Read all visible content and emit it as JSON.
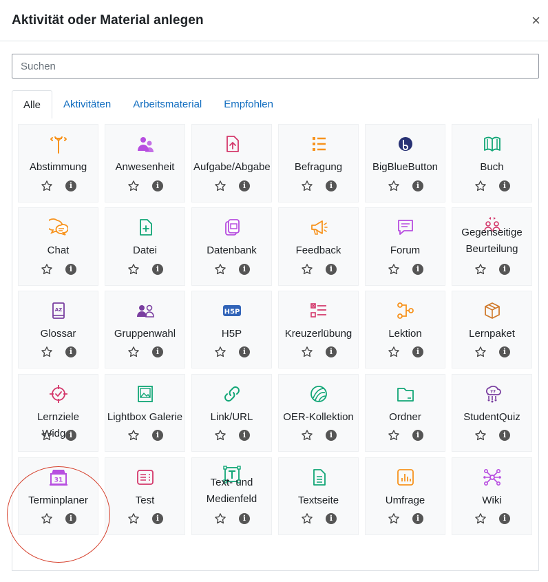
{
  "modal": {
    "title": "Aktivität oder Material anlegen",
    "close_symbol": "×"
  },
  "search": {
    "placeholder": "Suchen",
    "value": ""
  },
  "tabs": [
    {
      "label": "Alle",
      "active": true
    },
    {
      "label": "Aktivitäten",
      "active": false
    },
    {
      "label": "Arbeitsmaterial",
      "active": false
    },
    {
      "label": "Empfohlen",
      "active": false
    }
  ],
  "items": [
    {
      "label": "Abstimmung",
      "icon": "signpost-icon",
      "color": "#f7931e"
    },
    {
      "label": "Anwesenheit",
      "icon": "attendance-icon",
      "color": "#b74ee0"
    },
    {
      "label": "Aufgabe/Abgabe",
      "icon": "file-upload-icon",
      "color": "#d4386b"
    },
    {
      "label": "Befragung",
      "icon": "list-icon",
      "color": "#f7931e"
    },
    {
      "label": "BigBlueButton",
      "icon": "bigbluebutton-icon",
      "color": "#283274"
    },
    {
      "label": "Buch",
      "icon": "book-icon",
      "color": "#11a676"
    },
    {
      "label": "Chat",
      "icon": "chat-icon",
      "color": "#f7931e"
    },
    {
      "label": "Datei",
      "icon": "file-plus-icon",
      "color": "#11a676"
    },
    {
      "label": "Datenbank",
      "icon": "database-icon",
      "color": "#b74ee0"
    },
    {
      "label": "Feedback",
      "icon": "megaphone-icon",
      "color": "#f7931e"
    },
    {
      "label": "Forum",
      "icon": "forum-icon",
      "color": "#b74ee0"
    },
    {
      "label": "Gegenseitige Beurteilung",
      "icon": "peer-review-icon",
      "color": "#d4386b"
    },
    {
      "label": "Glossar",
      "icon": "glossary-icon",
      "color": "#7a3fa0"
    },
    {
      "label": "Gruppenwahl",
      "icon": "group-icon",
      "color": "#7a3fa0"
    },
    {
      "label": "H5P",
      "icon": "h5p-icon",
      "color": "#3264b8"
    },
    {
      "label": "Kreuzerlübung",
      "icon": "checklist-icon",
      "color": "#d4386b"
    },
    {
      "label": "Lektion",
      "icon": "lesson-icon",
      "color": "#f7931e"
    },
    {
      "label": "Lernpaket",
      "icon": "package-icon",
      "color": "#d07a2c"
    },
    {
      "label": "Lernziele Widget",
      "icon": "target-icon",
      "color": "#d4386b"
    },
    {
      "label": "Lightbox Galerie",
      "icon": "gallery-icon",
      "color": "#11a676"
    },
    {
      "label": "Link/URL",
      "icon": "link-icon",
      "color": "#11a676"
    },
    {
      "label": "OER-Kollektion",
      "icon": "oer-icon",
      "color": "#11a676"
    },
    {
      "label": "Ordner",
      "icon": "folder-icon",
      "color": "#11a676"
    },
    {
      "label": "StudentQuiz",
      "icon": "studentquiz-icon",
      "color": "#7a3fa0"
    },
    {
      "label": "Terminplaner",
      "icon": "calendar-icon",
      "color": "#b74ee0"
    },
    {
      "label": "Test",
      "icon": "quiz-icon",
      "color": "#d4386b"
    },
    {
      "label": "Text- und Medienfeld",
      "icon": "text-media-icon",
      "color": "#11a676"
    },
    {
      "label": "Textseite",
      "icon": "page-icon",
      "color": "#11a676"
    },
    {
      "label": "Umfrage",
      "icon": "survey-icon",
      "color": "#f7931e"
    },
    {
      "label": "Wiki",
      "icon": "wiki-icon",
      "color": "#b74ee0"
    }
  ],
  "tile_actions": {
    "star_icon": "star-outline-icon",
    "info_symbol": "i"
  },
  "highlight_color": "#d6412d"
}
